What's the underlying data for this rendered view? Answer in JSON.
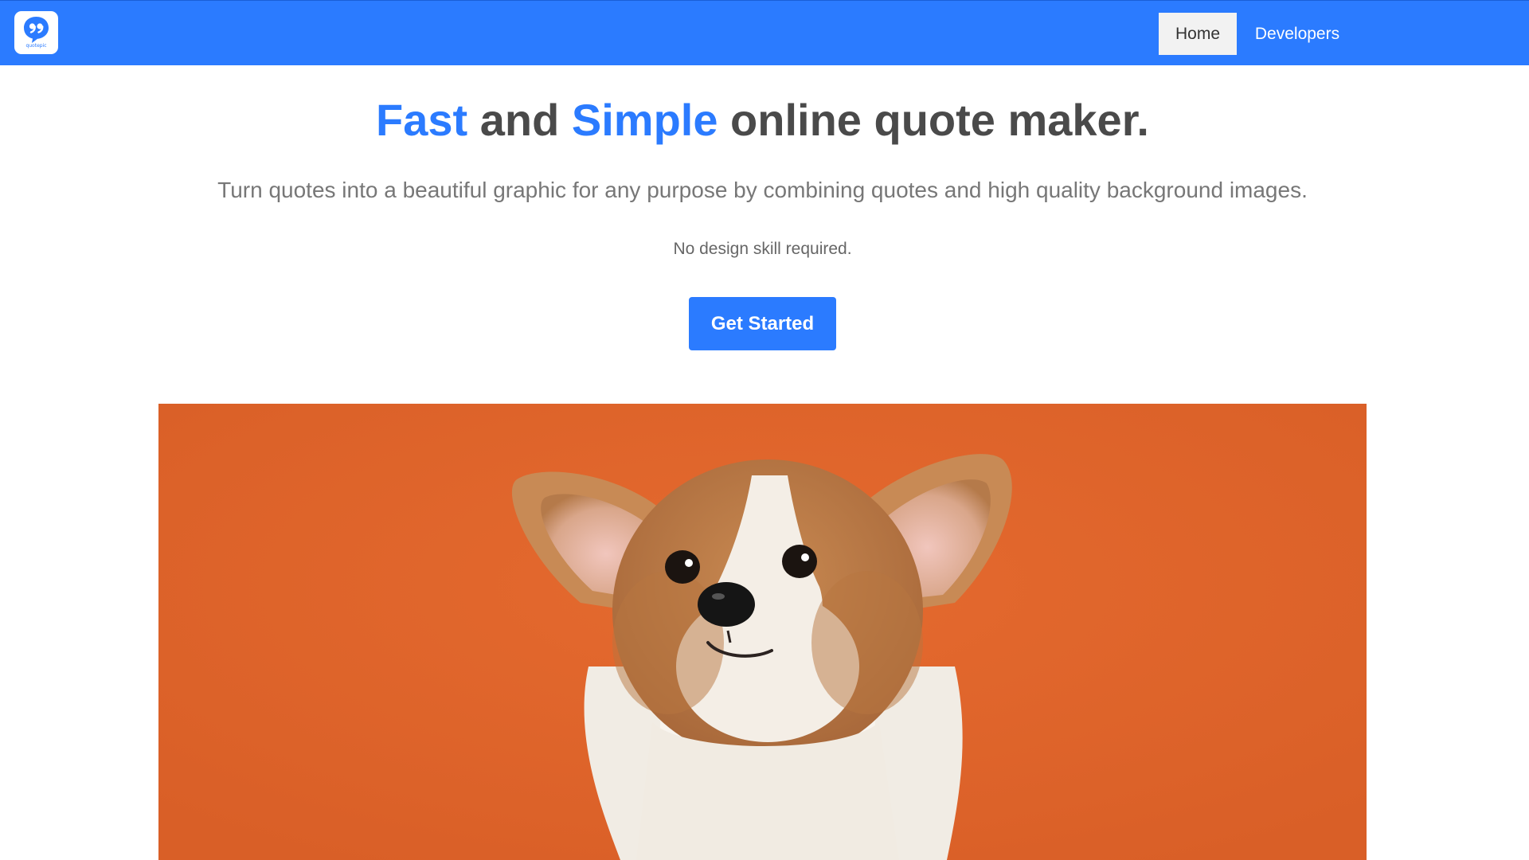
{
  "navbar": {
    "logo_text": "quotepic",
    "items": [
      {
        "label": "Home",
        "active": true
      },
      {
        "label": "Developers",
        "active": false
      }
    ]
  },
  "hero": {
    "title_parts": [
      "Fast",
      " and ",
      "Simple",
      " online quote maker."
    ],
    "subtitle": "Turn quotes into a beautiful graphic for any purpose by combining quotes and high quality background images.",
    "tagline": "No design skill required.",
    "cta_label": "Get Started",
    "image_subject": "corgi-puppy-photo"
  },
  "colors": {
    "brand": "#2b7bff",
    "heading": "#4a4a4a",
    "hero_background": "#e0662b"
  }
}
